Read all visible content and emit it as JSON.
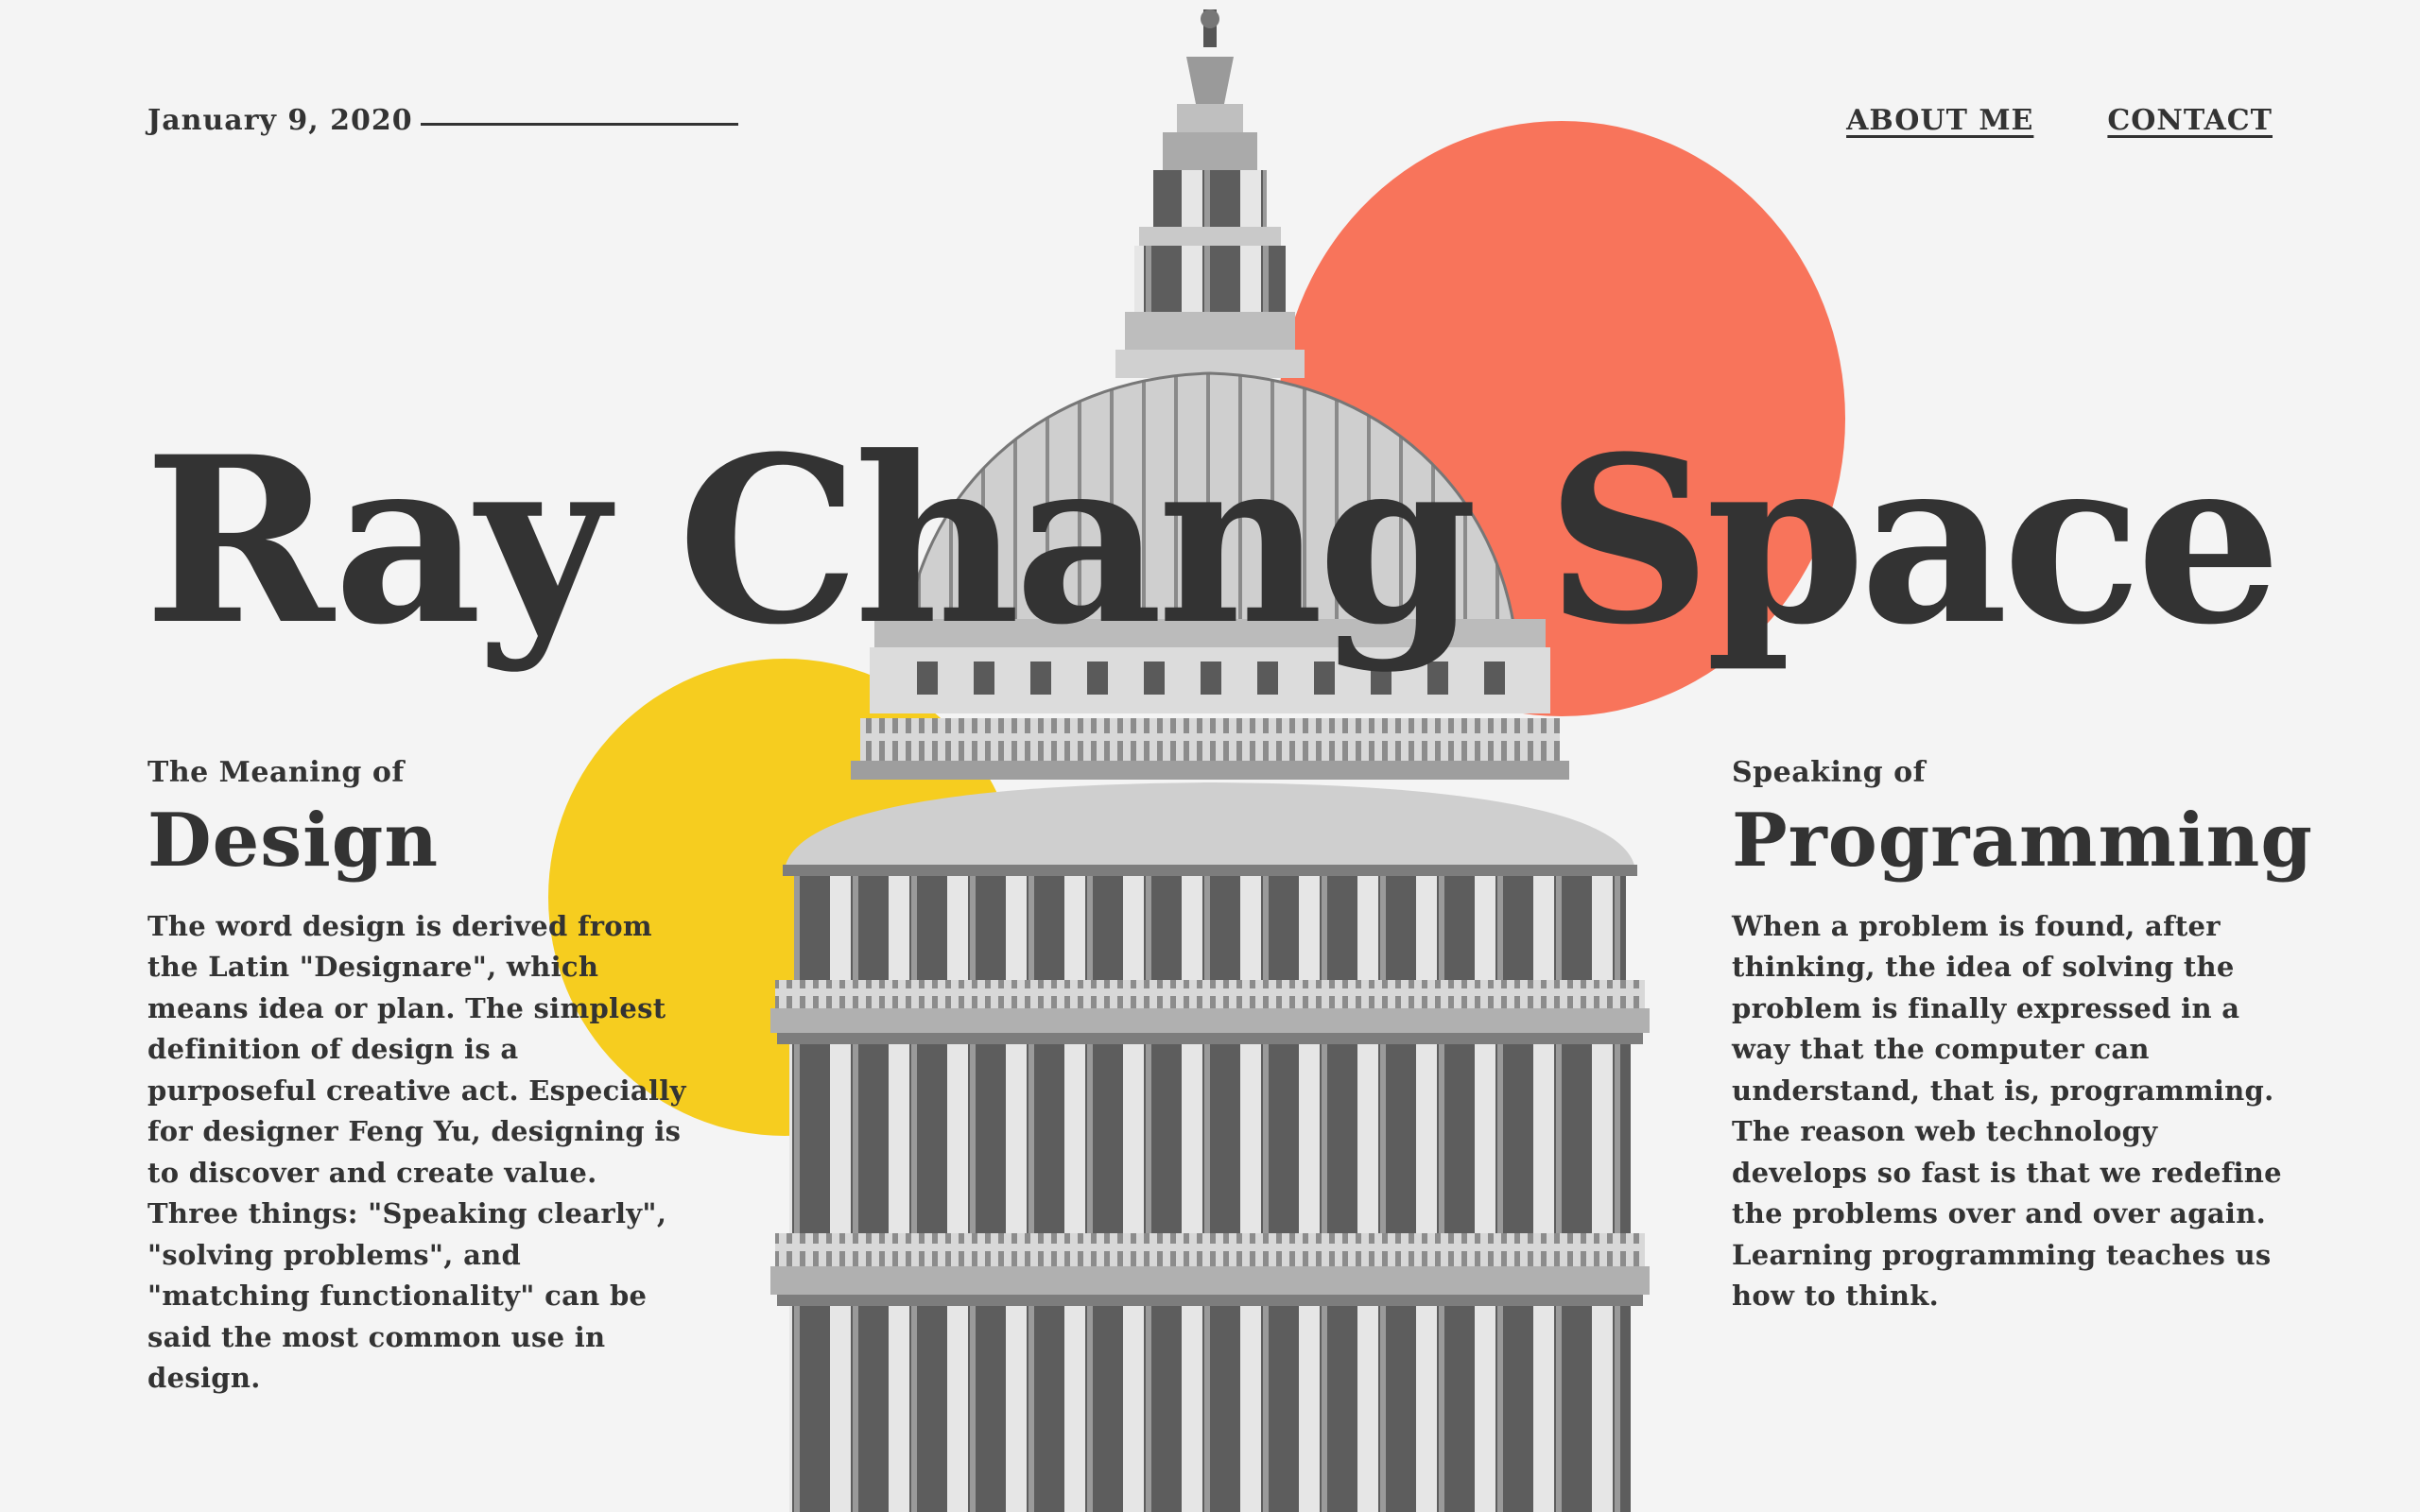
{
  "header": {
    "date": "January 9, 2020",
    "nav": [
      {
        "label": "ABOUT ME"
      },
      {
        "label": "CONTACT"
      }
    ]
  },
  "hero": {
    "title": "Ray Chang Space"
  },
  "left_column": {
    "kicker": "The Meaning of",
    "heading": "Design",
    "body": "The word design is derived from the Latin \"Designare\", which means idea or plan. The simplest definition of design is a purposeful creative act. Especially for designer Feng Yu, designing is to discover and create value. Three things: \"Speaking clearly\", \"solving problems\", and \"matching functionality\" can be said the most common use in design."
  },
  "right_column": {
    "kicker": "Speaking of",
    "heading": "Programming",
    "body": "When a problem is found, after thinking, the idea of solving the problem is finally expressed in a way that the computer can understand, that is, programming. The reason web technology develops so fast is that we redefine the problems over and over again. Learning programming teaches us how to think."
  },
  "colors": {
    "background": "#f4f4f4",
    "text": "#333333",
    "red_circle": "#f8745b",
    "yellow_circle": "#f6cd1f"
  }
}
